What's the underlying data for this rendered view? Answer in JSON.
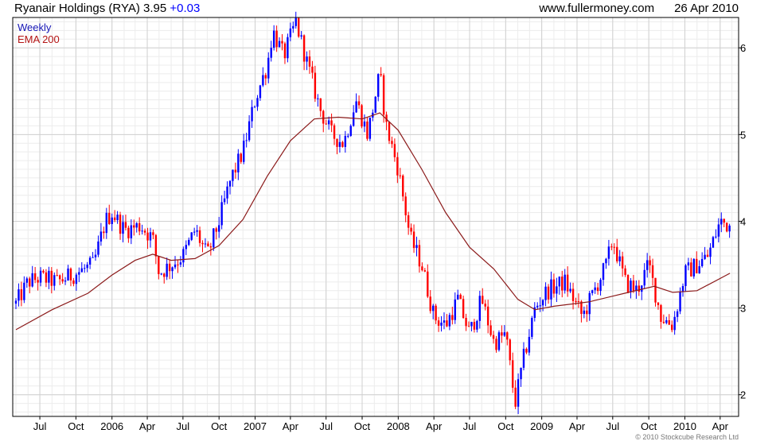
{
  "header": {
    "ticker": "Ryanair Holdings (RYA)",
    "price": "3.95",
    "change": "+0.03",
    "source": "www.fullermoney.com",
    "date": "26 Apr 2010"
  },
  "legend": {
    "period": "Weekly",
    "indicator": "EMA 200"
  },
  "copyright": "© 2010 Stockcube Research Ltd",
  "colors": {
    "up": "#0000ff",
    "down": "#ff0000",
    "ema": "#8b1a1a",
    "grid": "#d0d0d0",
    "axis": "#000000"
  },
  "chart_data": {
    "type": "candlestick",
    "period": "weekly",
    "ylim": [
      1.75,
      6.35
    ],
    "yticks": [
      2,
      3,
      4,
      5,
      6
    ],
    "xticks": [
      "Jul",
      "Oct",
      "2006",
      "Apr",
      "Jul",
      "Oct",
      "2007",
      "Apr",
      "Jul",
      "Oct",
      "2008",
      "Apr",
      "Jul",
      "Oct",
      "2009",
      "Apr",
      "Jul",
      "Oct",
      "2010",
      "Apr"
    ],
    "grid": true,
    "y_axis_side": "right",
    "price_series": {
      "name": "Weekly",
      "keypoints": [
        [
          "2005-05-01",
          3.05
        ],
        [
          "2005-06-01",
          3.3
        ],
        [
          "2005-07-01",
          3.35
        ],
        [
          "2005-08-15",
          3.3
        ],
        [
          "2005-10-01",
          3.4
        ],
        [
          "2005-11-15",
          3.5
        ],
        [
          "2005-12-15",
          4.0
        ],
        [
          "2006-01-01",
          4.1
        ],
        [
          "2006-02-01",
          3.9
        ],
        [
          "2006-03-15",
          3.95
        ],
        [
          "2006-04-15",
          3.8
        ],
        [
          "2006-05-01",
          3.4
        ],
        [
          "2006-06-01",
          3.5
        ],
        [
          "2006-07-01",
          3.6
        ],
        [
          "2006-08-01",
          3.9
        ],
        [
          "2006-09-01",
          3.6
        ],
        [
          "2006-10-01",
          4.0
        ],
        [
          "2006-11-01",
          4.5
        ],
        [
          "2006-12-01",
          4.8
        ],
        [
          "2007-01-01",
          5.4
        ],
        [
          "2007-02-01",
          5.8
        ],
        [
          "2007-02-15",
          6.2
        ],
        [
          "2007-03-15",
          5.9
        ],
        [
          "2007-04-15",
          6.3
        ],
        [
          "2007-05-15",
          5.8
        ],
        [
          "2007-06-15",
          5.3
        ],
        [
          "2007-07-15",
          5.0
        ],
        [
          "2007-08-15",
          4.9
        ],
        [
          "2007-09-15",
          5.4
        ],
        [
          "2007-10-15",
          5.0
        ],
        [
          "2007-11-15",
          5.7
        ],
        [
          "2007-12-01",
          5.1
        ],
        [
          "2008-01-01",
          4.6
        ],
        [
          "2008-02-01",
          3.8
        ],
        [
          "2008-03-01",
          3.5
        ],
        [
          "2008-04-01",
          2.9
        ],
        [
          "2008-05-01",
          2.8
        ],
        [
          "2008-06-01",
          3.1
        ],
        [
          "2008-07-01",
          2.7
        ],
        [
          "2008-08-01",
          3.1
        ],
        [
          "2008-09-01",
          2.6
        ],
        [
          "2008-10-01",
          2.7
        ],
        [
          "2008-10-25",
          1.9
        ],
        [
          "2008-11-15",
          2.4
        ],
        [
          "2008-12-15",
          3.0
        ],
        [
          "2009-01-15",
          3.2
        ],
        [
          "2009-03-01",
          3.3
        ],
        [
          "2009-04-15",
          2.9
        ],
        [
          "2009-05-15",
          3.2
        ],
        [
          "2009-06-15",
          3.5
        ],
        [
          "2009-07-01",
          3.8
        ],
        [
          "2009-08-01",
          3.3
        ],
        [
          "2009-09-01",
          3.2
        ],
        [
          "2009-10-01",
          3.5
        ],
        [
          "2009-11-01",
          2.9
        ],
        [
          "2009-12-01",
          2.8
        ],
        [
          "2010-01-01",
          3.4
        ],
        [
          "2010-02-01",
          3.5
        ],
        [
          "2010-03-01",
          3.6
        ],
        [
          "2010-04-01",
          4.0
        ],
        [
          "2010-04-26",
          3.95
        ]
      ]
    },
    "ema_series": {
      "name": "EMA 200",
      "values": [
        [
          "2005-05-01",
          2.75
        ],
        [
          "2005-08-01",
          2.98
        ],
        [
          "2005-11-01",
          3.17
        ],
        [
          "2006-01-01",
          3.38
        ],
        [
          "2006-03-01",
          3.55
        ],
        [
          "2006-04-15",
          3.62
        ],
        [
          "2006-06-01",
          3.55
        ],
        [
          "2006-08-01",
          3.57
        ],
        [
          "2006-10-01",
          3.72
        ],
        [
          "2006-12-01",
          4.02
        ],
        [
          "2007-02-01",
          4.52
        ],
        [
          "2007-04-01",
          4.93
        ],
        [
          "2007-06-01",
          5.18
        ],
        [
          "2007-08-01",
          5.2
        ],
        [
          "2007-10-01",
          5.18
        ],
        [
          "2007-11-15",
          5.25
        ],
        [
          "2008-01-01",
          5.05
        ],
        [
          "2008-03-01",
          4.6
        ],
        [
          "2008-05-01",
          4.1
        ],
        [
          "2008-07-01",
          3.7
        ],
        [
          "2008-09-01",
          3.45
        ],
        [
          "2008-11-01",
          3.1
        ],
        [
          "2008-12-15",
          2.98
        ],
        [
          "2009-02-01",
          3.02
        ],
        [
          "2009-05-01",
          3.07
        ],
        [
          "2009-08-01",
          3.17
        ],
        [
          "2009-10-15",
          3.25
        ],
        [
          "2009-12-01",
          3.18
        ],
        [
          "2010-02-01",
          3.2
        ],
        [
          "2010-04-26",
          3.4
        ]
      ]
    }
  }
}
